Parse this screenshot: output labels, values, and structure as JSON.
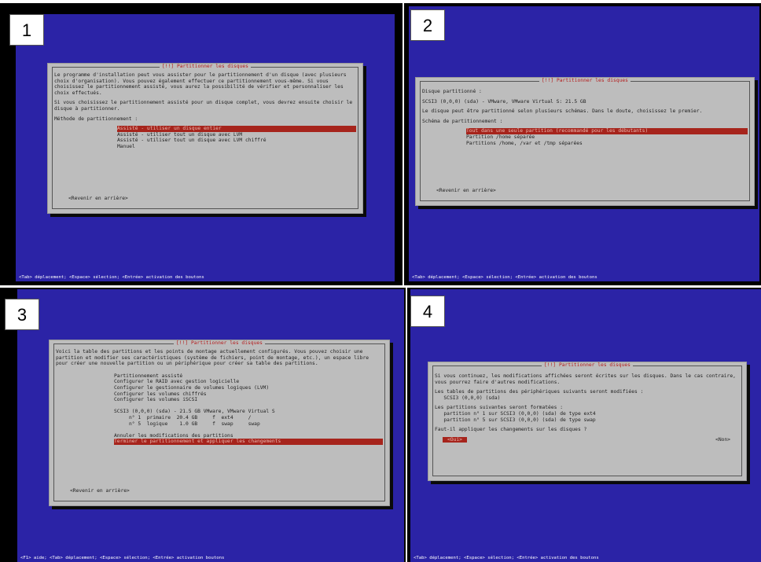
{
  "panels": [
    {
      "number": "1",
      "title": "[!!] Partitionner les disques",
      "paragraphs": [
        "Le programme d'installation peut vous assister pour le partitionnement d'un disque (avec plusieurs choix d'organisation). Vous pouvez également effectuer ce partitionnement vous-même. Si vous choisissez le partitionnement assisté, vous aurez la possibilité de vérifier et personnaliser les choix effectués.",
        "Si vous choisissez le partitionnement assisté pour un disque complet, vous devrez ensuite choisir le disque à partitionner.",
        "Méthode de partitionnement :"
      ],
      "options": [
        "Assisté - utiliser un disque entier",
        "Assisté - utiliser tout un disque avec LVM",
        "Assisté - utiliser tout un disque avec LVM chiffré",
        "Manuel"
      ],
      "selected_index": 0,
      "back": "<Revenir en arrière>",
      "status": "<Tab> déplacement; <Espace> sélection; <Entrée> activation des boutons"
    },
    {
      "number": "2",
      "title": "[!!] Partitionner les disques",
      "paragraphs": [
        "Disque partitionné :",
        "SCSI3 (0,0,0) (sda) - VMware, VMware Virtual S: 21.5 GB",
        "Le disque peut être partitionné selon plusieurs schémas. Dans le doute, choisissez le premier.",
        "Schéma de partitionnement :"
      ],
      "options": [
        "Tout dans une seule partition (recommandé pour les débutants)",
        "Partition /home séparée",
        "Partitions /home, /var et /tmp séparées"
      ],
      "selected_index": 0,
      "back": "<Revenir en arrière>",
      "status": "<Tab> déplacement; <Espace> sélection; <Entrée> activation des boutons"
    },
    {
      "number": "3",
      "title": "[!!] Partitionner les disques",
      "paragraphs": [
        "Voici la table des partitions et les points de montage actuellement configurés. Vous pouvez choisir une partition et modifier ses caractéristiques (système de fichiers, point de montage, etc.), un espace libre pour créer une nouvelle partition ou un périphérique pour créer sa table des partitions."
      ],
      "options": [
        "Partitionnement assisté",
        "Configurer le RAID avec gestion logicielle",
        "Configurer le gestionnaire de volumes logiques (LVM)",
        "Configurer les volumes chiffrés",
        "Configurer les volumes iSCSI",
        "",
        "SCSI3 (0,0,0) (sda) - 21.5 GB VMware, VMware Virtual S",
        "     n° 1  primaire  20.4 GB     f  ext4     /",
        "     n° 5  logique    1.0 GB     f  swap     swap",
        "",
        "Annuler les modifications des partitions",
        "Terminer le partitionnement et appliquer les changements"
      ],
      "selected_index": 11,
      "back": "<Revenir en arrière>",
      "status": "<F1> aide; <Tab> déplacement; <Espace> sélection; <Entrée> activation boutons"
    },
    {
      "number": "4",
      "title": "[!!] Partitionner les disques",
      "paragraphs": [
        "Si vous continuez, les modifications affichées seront écrites sur les disques. Dans le cas contraire, vous pourrez faire d'autres modifications.",
        "Les tables de partitions des périphériques suivants seront modifiées :\n   SCSI3 (0,0,0) (sda)",
        "Les partitions suivantes seront formatées :\n   partition n° 1 sur SCSI3 (0,0,0) (sda) de type ext4\n   partition n° 5 sur SCSI3 (0,0,0) (sda) de type swap",
        "Faut-il appliquer les changements sur les disques ?"
      ],
      "yes_button": "<Oui>",
      "no_button": "<Non>",
      "status": "<Tab> déplacement; <Espace> sélection; <Entrée> activation des boutons"
    }
  ],
  "colors": {
    "screen_blue": "#2b23a6",
    "dialog_gray": "#bdbdbd",
    "highlight_red": "#a6241c",
    "title_red": "#b31e1e"
  }
}
